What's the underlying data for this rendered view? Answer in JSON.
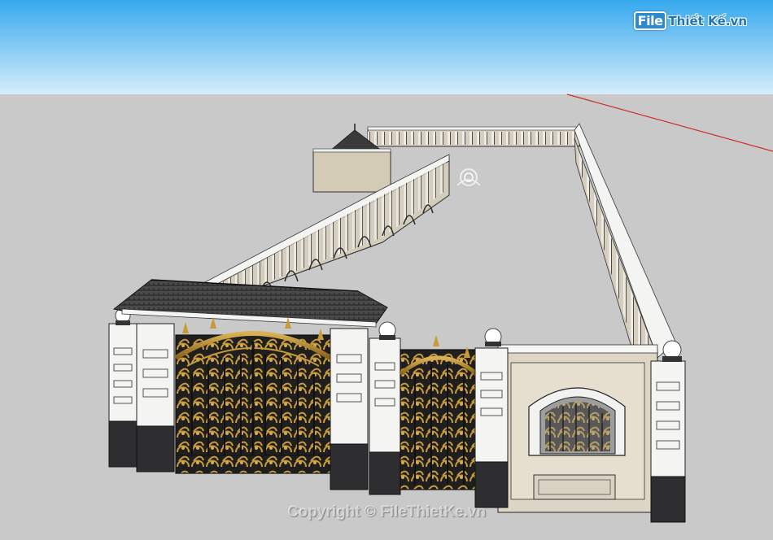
{
  "watermark": {
    "logo_badge": "File",
    "logo_text": "Thiết Kế.vn",
    "copyright": "Copyright © FileThietKe.vn"
  },
  "colors": {
    "sky_top": "#36a9ee",
    "sky_bottom": "#d6edfb",
    "ground": "#c9c9c9",
    "wall_cream": "#d9d2c3",
    "pillar_white": "#f4f4f2",
    "pillar_dark": "#2e2e30",
    "gate_gold": "#b48a2e",
    "gate_black": "#1d1d1d",
    "roof_tile": "#3b3b3b",
    "axis_red": "#c9302c"
  }
}
